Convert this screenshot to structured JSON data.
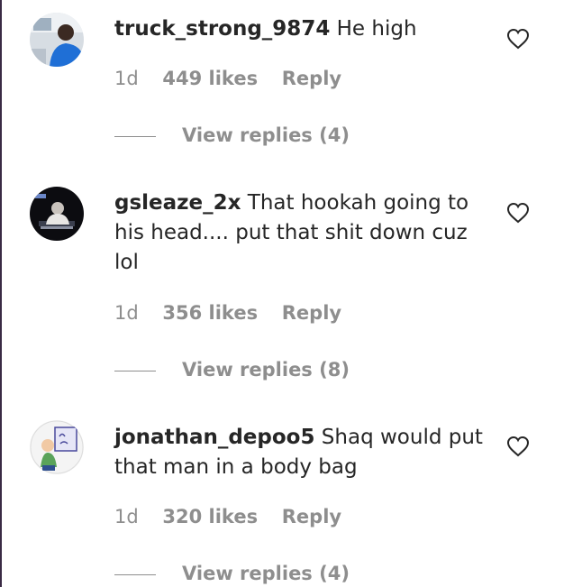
{
  "comments": [
    {
      "username": "truck_strong_9874",
      "text": "He high",
      "time": "1d",
      "likes": "449 likes",
      "reply": "Reply",
      "view_replies": "View replies (4)",
      "avatar_icon": "profile-photo-blue-hoodie"
    },
    {
      "username": "gsleaze_2x",
      "text": "That hookah going to his head.... put that shit down cuz lol",
      "time": "1d",
      "likes": "356 likes",
      "reply": "Reply",
      "view_replies": "View replies (8)",
      "avatar_icon": "profile-photo-dark-room"
    },
    {
      "username": "jonathan_depoo5",
      "text": "Shaq would put that man in a body bag",
      "time": "1d",
      "likes": "320 likes",
      "reply": "Reply",
      "view_replies": "View replies (4)",
      "avatar_icon": "profile-cartoon-sign"
    }
  ],
  "colors": {
    "primary_text": "#262626",
    "secondary_text": "#8e8e8e",
    "background": "#ffffff"
  }
}
